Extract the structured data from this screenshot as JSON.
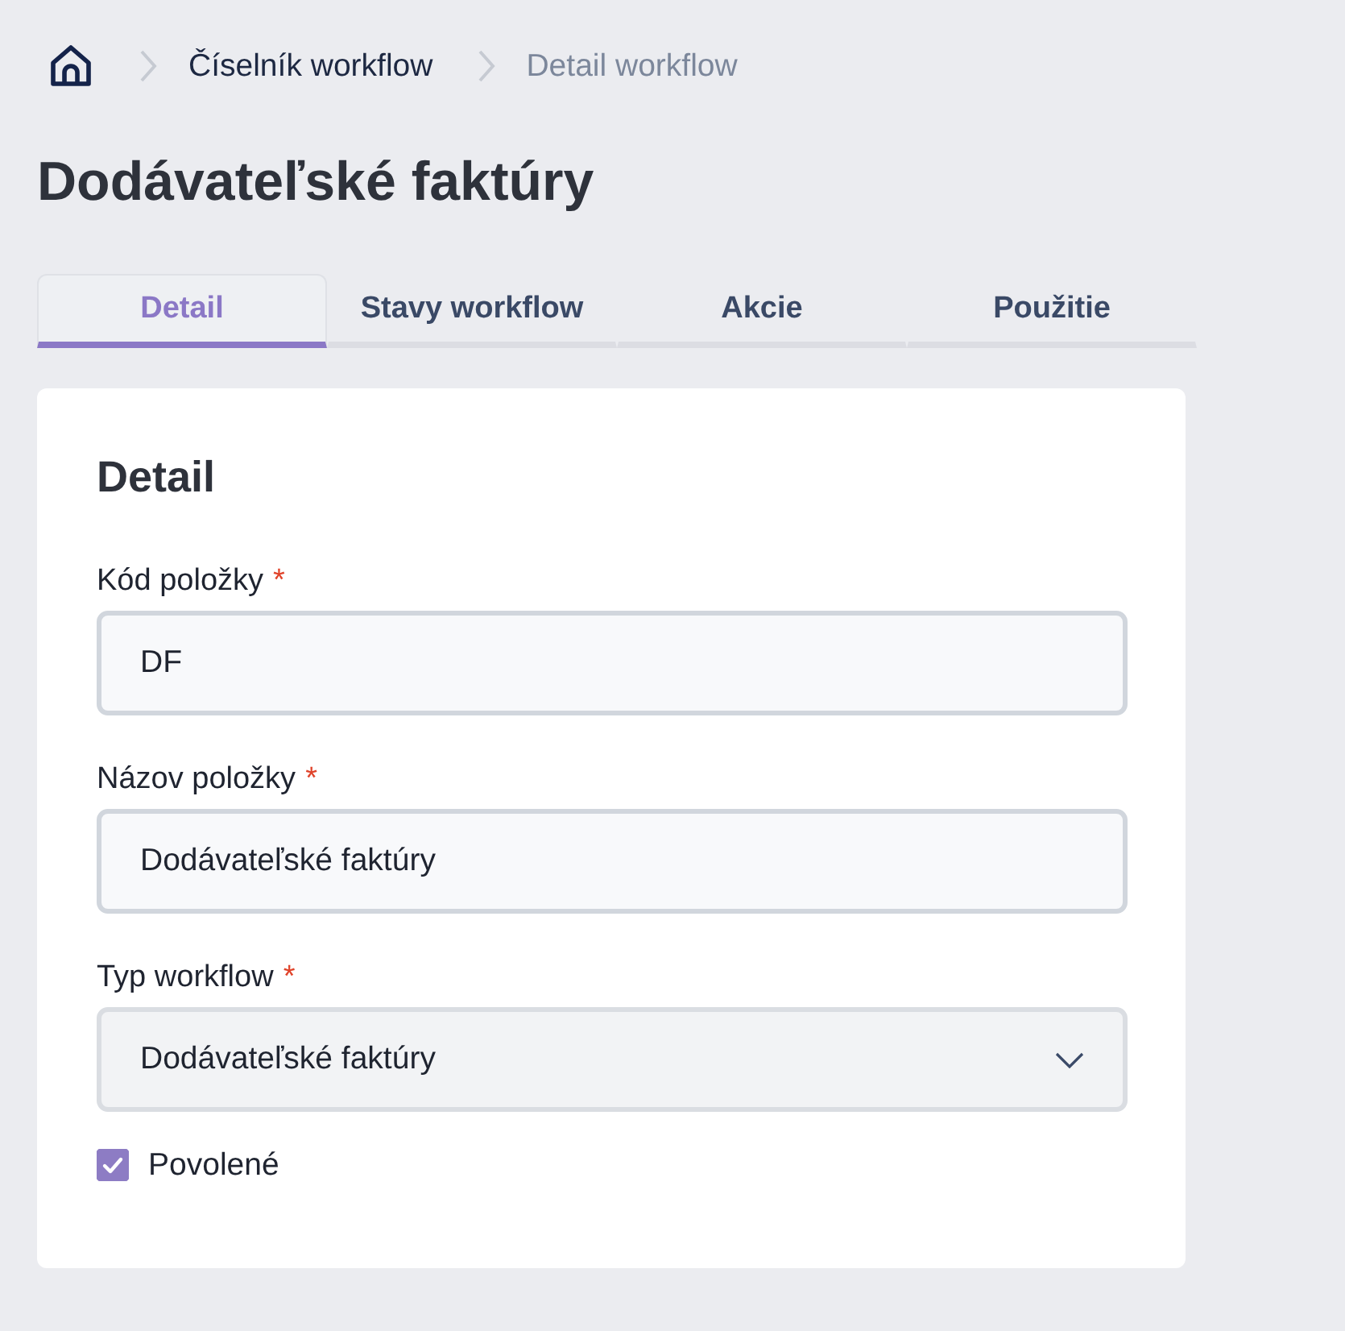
{
  "breadcrumb": {
    "items": [
      {
        "label": "Číselník workflow",
        "current": false
      },
      {
        "label": "Detail workflow",
        "current": true
      }
    ]
  },
  "page_title": "Dodávateľské faktúry",
  "tabs": [
    {
      "label": "Detail",
      "selected": true
    },
    {
      "label": "Stavy workflow",
      "selected": false
    },
    {
      "label": "Akcie",
      "selected": false
    },
    {
      "label": "Použitie",
      "selected": false
    }
  ],
  "card": {
    "title": "Detail",
    "fields": [
      {
        "kind": "text",
        "label": "Kód položky",
        "required_mark": "*",
        "value": "DF"
      },
      {
        "kind": "text",
        "label": "Názov položky",
        "required_mark": "*",
        "value": "Dodávateľské faktúry"
      },
      {
        "kind": "select",
        "label": "Typ workflow",
        "required_mark": "*",
        "value": "Dodávateľské faktúry"
      }
    ],
    "checkbox": {
      "label": "Povolené",
      "checked": true
    }
  }
}
